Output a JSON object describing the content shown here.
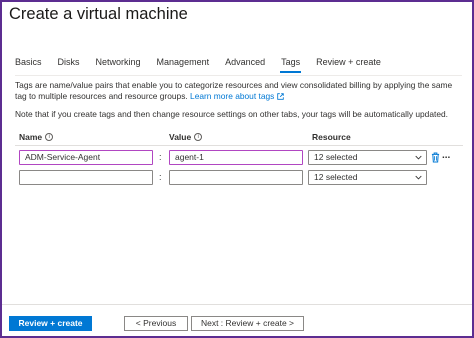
{
  "window": {
    "title": "Create a virtual machine"
  },
  "tabs": [
    {
      "label": "Basics",
      "active": false
    },
    {
      "label": "Disks",
      "active": false
    },
    {
      "label": "Networking",
      "active": false
    },
    {
      "label": "Management",
      "active": false
    },
    {
      "label": "Advanced",
      "active": false
    },
    {
      "label": "Tags",
      "active": true
    },
    {
      "label": "Review + create",
      "active": false
    }
  ],
  "description": {
    "text": "Tags are name/value pairs that enable you to categorize resources and view consolidated billing by applying the same tag to multiple resources and resource groups.",
    "link_label": "Learn more about tags",
    "link_icon": "external-link-icon"
  },
  "note": "Note that if you create tags and then change resource settings on other tabs, your tags will be automatically updated.",
  "columns": {
    "name": "Name",
    "value": "Value",
    "resource": "Resource"
  },
  "rows": [
    {
      "name": "ADM-Service-Agent",
      "separator": ":",
      "value": "agent-1",
      "resource": "12 selected"
    },
    {
      "name": "",
      "separator": ":",
      "value": "",
      "resource": "12 selected"
    }
  ],
  "row_actions": {
    "delete_icon": "trash-icon",
    "more_label": "..."
  },
  "footer": {
    "review_create_label": "Review + create",
    "previous_label": "< Previous",
    "next_label": "Next : Review + create >"
  },
  "colors": {
    "accent": "#0078d4",
    "highlight_border": "#b146c2",
    "frame_border": "#5c2d91"
  }
}
